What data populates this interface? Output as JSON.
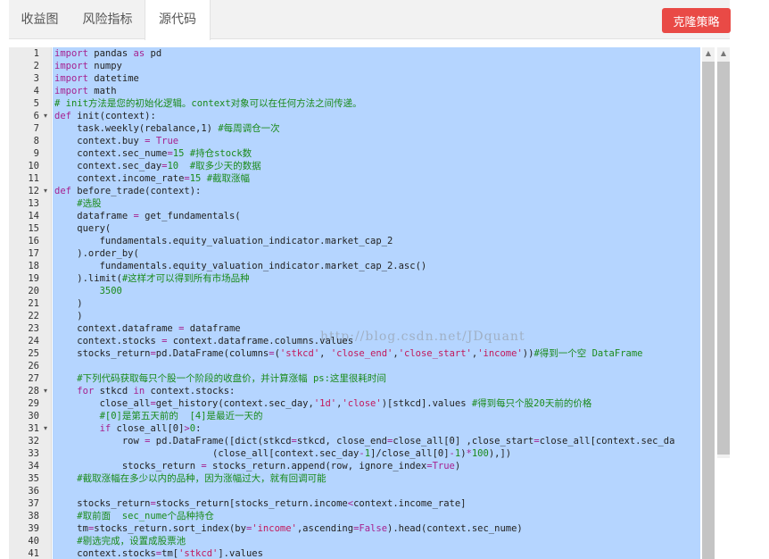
{
  "tabs": [
    {
      "label": "收益图"
    },
    {
      "label": "风险指标"
    },
    {
      "label": "源代码"
    }
  ],
  "clone_button": {
    "label": "克隆策略"
  },
  "watermark": "http://blog.csdn.net/JDquant",
  "colors": {
    "accent": "#e94a46",
    "selection": "#b5d5ff",
    "keyword": "#a6218f",
    "comment": "#1a8a1a",
    "string": "#c2185b"
  },
  "icons": {
    "fold": "caret-down-icon",
    "scroll_up": "scroll-up-arrow-icon"
  },
  "code": {
    "folded_lines": [
      6,
      12,
      28,
      31
    ],
    "lines": [
      [
        [
          "kw",
          "import"
        ],
        [
          "t",
          " pandas "
        ],
        [
          "kw",
          "as"
        ],
        [
          "t",
          " pd"
        ]
      ],
      [
        [
          "kw",
          "import"
        ],
        [
          "t",
          " numpy"
        ]
      ],
      [
        [
          "kw",
          "import"
        ],
        [
          "t",
          " datetime"
        ]
      ],
      [
        [
          "kw",
          "import"
        ],
        [
          "t",
          " math"
        ]
      ],
      [
        [
          "cm",
          "# init方法是您的初始化逻辑。context对象可以在任何方法之间传递。"
        ]
      ],
      [
        [
          "kw",
          "def"
        ],
        [
          "t",
          " init(context):"
        ]
      ],
      [
        [
          "t",
          "    task.weekly(rebalance,1) "
        ],
        [
          "cm",
          "#每周调仓一次"
        ]
      ],
      [
        [
          "t",
          "    context.buy "
        ],
        [
          "kw",
          "="
        ],
        [
          "t",
          " "
        ],
        [
          "kw",
          "True"
        ]
      ],
      [
        [
          "t",
          "    context.sec_nume"
        ],
        [
          "kw",
          "="
        ],
        [
          "nm",
          "15"
        ],
        [
          "t",
          " "
        ],
        [
          "cm",
          "#持仓stock数"
        ]
      ],
      [
        [
          "t",
          "    context.sec_day"
        ],
        [
          "kw",
          "="
        ],
        [
          "nm",
          "10"
        ],
        [
          "t",
          "  "
        ],
        [
          "cm",
          "#取多少天的数据"
        ]
      ],
      [
        [
          "t",
          "    context.income_rate"
        ],
        [
          "kw",
          "="
        ],
        [
          "nm",
          "15"
        ],
        [
          "t",
          " "
        ],
        [
          "cm",
          "#截取涨幅"
        ]
      ],
      [
        [
          "kw",
          "def"
        ],
        [
          "t",
          " before_trade(context):"
        ]
      ],
      [
        [
          "t",
          "    "
        ],
        [
          "cm",
          "#选股"
        ]
      ],
      [
        [
          "t",
          "    dataframe "
        ],
        [
          "kw",
          "="
        ],
        [
          "t",
          " get_fundamentals("
        ]
      ],
      [
        [
          "t",
          "    query("
        ]
      ],
      [
        [
          "t",
          "        fundamentals.equity_valuation_indicator.market_cap_2"
        ]
      ],
      [
        [
          "t",
          "    ).order_by("
        ]
      ],
      [
        [
          "t",
          "        fundamentals.equity_valuation_indicator.market_cap_2.asc()"
        ]
      ],
      [
        [
          "t",
          "    ).limit("
        ],
        [
          "cm",
          "#这样才可以得到所有市场品种"
        ]
      ],
      [
        [
          "t",
          "        "
        ],
        [
          "nm",
          "3500"
        ]
      ],
      [
        [
          "t",
          "    )"
        ]
      ],
      [
        [
          "t",
          "    )"
        ]
      ],
      [
        [
          "t",
          "    context.dataframe "
        ],
        [
          "kw",
          "="
        ],
        [
          "t",
          " dataframe"
        ]
      ],
      [
        [
          "t",
          "    context.stocks "
        ],
        [
          "kw",
          "="
        ],
        [
          "t",
          " context.dataframe.columns.values"
        ]
      ],
      [
        [
          "t",
          "    stocks_return"
        ],
        [
          "kw",
          "="
        ],
        [
          "t",
          "pd.DataFrame(columns"
        ],
        [
          "kw",
          "="
        ],
        [
          "t",
          "("
        ],
        [
          "st",
          "'stkcd'"
        ],
        [
          "t",
          ", "
        ],
        [
          "st",
          "'close_end'"
        ],
        [
          "t",
          ","
        ],
        [
          "st",
          "'close_start'"
        ],
        [
          "t",
          ","
        ],
        [
          "st",
          "'income'"
        ],
        [
          "t",
          "))"
        ],
        [
          "cm",
          "#得到一个空 DataFrame"
        ]
      ],
      [
        [
          "t",
          ""
        ]
      ],
      [
        [
          "t",
          "    "
        ],
        [
          "cm",
          "#下列代码获取每只个股一个阶段的收盘价，并计算涨幅 ps:这里很耗时间"
        ]
      ],
      [
        [
          "t",
          "    "
        ],
        [
          "kw",
          "for"
        ],
        [
          "t",
          " stkcd "
        ],
        [
          "kw",
          "in"
        ],
        [
          "t",
          " context.stocks:"
        ]
      ],
      [
        [
          "t",
          "        close_all"
        ],
        [
          "kw",
          "="
        ],
        [
          "t",
          "get_history(context.sec_day,"
        ],
        [
          "st",
          "'1d'"
        ],
        [
          "t",
          ","
        ],
        [
          "st",
          "'close'"
        ],
        [
          "t",
          ")[stkcd].values "
        ],
        [
          "cm",
          "#得到每只个股20天前的价格"
        ]
      ],
      [
        [
          "t",
          "        "
        ],
        [
          "cm",
          "#[0]是第五天前的  [4]是最近一天的"
        ]
      ],
      [
        [
          "t",
          "        "
        ],
        [
          "kw",
          "if"
        ],
        [
          "t",
          " close_all[0]"
        ],
        [
          "kw",
          ">"
        ],
        [
          "nm",
          "0"
        ],
        [
          "t",
          ":"
        ]
      ],
      [
        [
          "t",
          "            row "
        ],
        [
          "kw",
          "="
        ],
        [
          "t",
          " pd.DataFrame([dict(stkcd"
        ],
        [
          "kw",
          "="
        ],
        [
          "t",
          "stkcd, close_end"
        ],
        [
          "kw",
          "="
        ],
        [
          "t",
          "close_all[0] ,close_start"
        ],
        [
          "kw",
          "="
        ],
        [
          "t",
          "close_all[context.sec_da"
        ]
      ],
      [
        [
          "t",
          "                            (close_all[context.sec_day"
        ],
        [
          "kw",
          "-"
        ],
        [
          "nm",
          "1"
        ],
        [
          "t",
          "]/close_all[0]"
        ],
        [
          "kw",
          "-"
        ],
        [
          "nm",
          "1"
        ],
        [
          "t",
          ")"
        ],
        [
          "kw",
          "*"
        ],
        [
          "nm",
          "100"
        ],
        [
          "t",
          "),])"
        ]
      ],
      [
        [
          "t",
          "            stocks_return "
        ],
        [
          "kw",
          "="
        ],
        [
          "t",
          " stocks_return.append(row, ignore_index"
        ],
        [
          "kw",
          "="
        ],
        [
          "kw",
          "True"
        ],
        [
          "t",
          ")"
        ]
      ],
      [
        [
          "t",
          "    "
        ],
        [
          "cm",
          "#截取涨幅在多少以内的品种，因为涨幅过大，就有回调可能"
        ]
      ],
      [
        [
          "t",
          ""
        ]
      ],
      [
        [
          "t",
          "    stocks_return"
        ],
        [
          "kw",
          "="
        ],
        [
          "t",
          "stocks_return[stocks_return.income"
        ],
        [
          "kw",
          "<"
        ],
        [
          "t",
          "context.income_rate]"
        ]
      ],
      [
        [
          "t",
          "    "
        ],
        [
          "cm",
          "#取前面  sec_nume个品种持仓"
        ]
      ],
      [
        [
          "t",
          "    tm"
        ],
        [
          "kw",
          "="
        ],
        [
          "t",
          "stocks_return.sort_index(by"
        ],
        [
          "kw",
          "="
        ],
        [
          "st",
          "'income'"
        ],
        [
          "t",
          ",ascending"
        ],
        [
          "kw",
          "="
        ],
        [
          "kw",
          "False"
        ],
        [
          "t",
          ").head(context.sec_nume)"
        ]
      ],
      [
        [
          "t",
          "    "
        ],
        [
          "cm",
          "#剔选完成，设置成股票池"
        ]
      ],
      [
        [
          "t",
          "    context.stocks"
        ],
        [
          "kw",
          "="
        ],
        [
          "t",
          "tm["
        ],
        [
          "st",
          "'stkcd'"
        ],
        [
          "t",
          "].values"
        ]
      ]
    ]
  }
}
